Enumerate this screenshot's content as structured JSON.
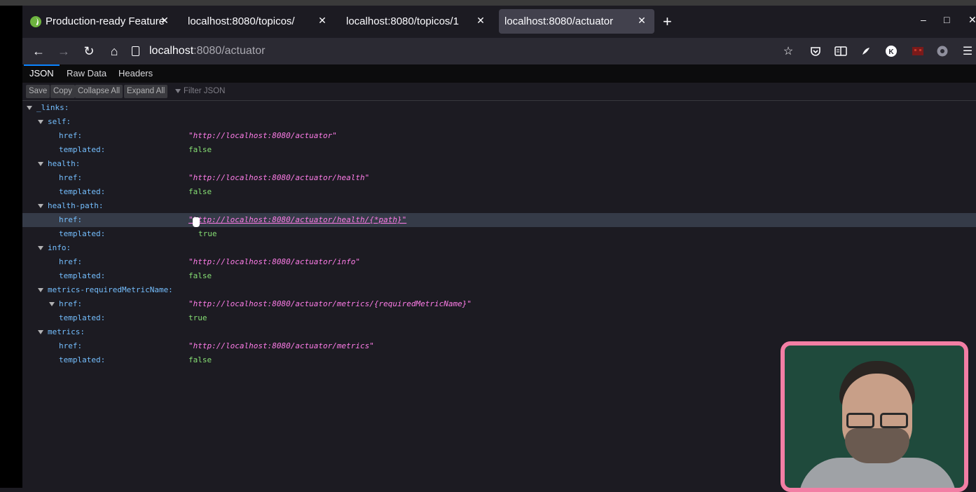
{
  "browser": {
    "tabs": [
      {
        "label": "Production-ready Features",
        "active": false
      },
      {
        "label": "localhost:8080/topicos/",
        "active": false
      },
      {
        "label": "localhost:8080/topicos/1",
        "active": false
      },
      {
        "label": "localhost:8080/actuator",
        "active": true
      }
    ],
    "new_tab": "+",
    "close_glyph": "✕",
    "window_controls": {
      "minimize": "–",
      "maximize": "□",
      "close": "✕"
    },
    "url": {
      "host": "localhost",
      "rest": ":8080/actuator"
    },
    "nav_icons": [
      "back-arrow-icon",
      "forward-arrow-icon",
      "reload-icon",
      "home-icon"
    ],
    "toolbar_icons": [
      "bookmark-star-icon",
      "pocket-icon",
      "reader-view-icon",
      "extension-icon",
      "account-icon",
      "extension-red-icon",
      "extension-gray-icon",
      "menu-icon"
    ],
    "accent_color": "#0a84ff"
  },
  "viewer": {
    "tabs": [
      "JSON",
      "Raw Data",
      "Headers"
    ],
    "buttons": [
      "Save",
      "Copy",
      "Collapse All",
      "Expand All"
    ],
    "filter_placeholder": "Filter JSON"
  },
  "tree": {
    "links_key": "_links:",
    "groups": [
      {
        "key": "self:",
        "href": "\"http://localhost:8080/actuator\"",
        "templated": "false"
      },
      {
        "key": "health:",
        "href": "\"http://localhost:8080/actuator/health\"",
        "templated": "false"
      },
      {
        "key": "health-path:",
        "href": "\"http://localhost:8080/actuator/health/{*path}\"",
        "templated": "true"
      },
      {
        "key": "info:",
        "href": "\"http://localhost:8080/actuator/info\"",
        "templated": "false"
      },
      {
        "key": "metrics-requiredMetricName:",
        "href": "\"http://localhost:8080/actuator/metrics/{requiredMetricName}\"",
        "templated": "true"
      },
      {
        "key": "metrics:",
        "href": "\"http://localhost:8080/actuator/metrics\"",
        "templated": "false"
      }
    ],
    "href_key": "href:",
    "templated_key": "templated:"
  },
  "colors": {
    "key": "#75bfff",
    "string": "#ff7de9",
    "boolean": "#86de74",
    "webcam_border": "#f27ea4"
  }
}
